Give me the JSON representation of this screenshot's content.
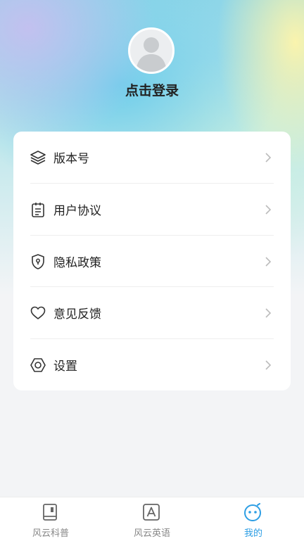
{
  "profile": {
    "login_text": "点击登录"
  },
  "menu": {
    "items": [
      {
        "label": "版本号",
        "icon": "layers-icon"
      },
      {
        "label": "用户协议",
        "icon": "clipboard-icon"
      },
      {
        "label": "隐私政策",
        "icon": "shield-keyhole-icon"
      },
      {
        "label": "意见反馈",
        "icon": "heart-icon"
      },
      {
        "label": "设置",
        "icon": "hexagon-settings-icon"
      }
    ]
  },
  "tabbar": {
    "tabs": [
      {
        "label": "风云科普",
        "icon": "book-icon",
        "active": false
      },
      {
        "label": "风云英语",
        "icon": "letter-a-icon",
        "active": false
      },
      {
        "label": "我的",
        "icon": "smiley-face-icon",
        "active": true
      }
    ]
  },
  "colors": {
    "accent": "#2d9ee4",
    "text": "#222222",
    "muted": "#888888"
  }
}
